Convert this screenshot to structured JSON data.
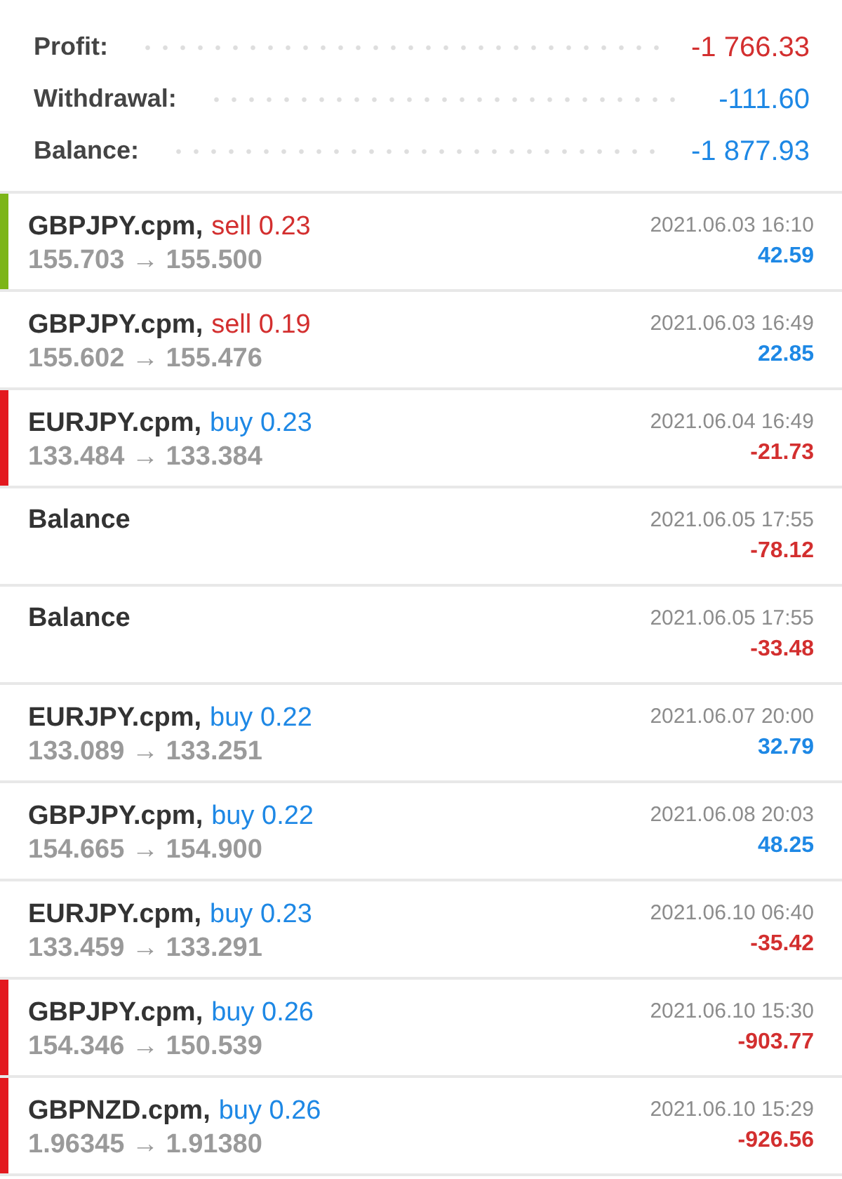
{
  "summary": [
    {
      "label": "Profit:",
      "value": "-1 766.33",
      "color": "#d32f2f"
    },
    {
      "label": "Withdrawal:",
      "value": "-111.60",
      "color": "#1e88e5"
    },
    {
      "label": "Balance:",
      "value": "-1 877.93",
      "color": "#1e88e5"
    }
  ],
  "rows": [
    {
      "kind": "trade",
      "color": "#7cb518",
      "symbol": "GBPJPY.cpm,",
      "order": {
        "text": "sell 0.23",
        "color": "#d32f2f"
      },
      "prices": "155.703 → 155.500",
      "time": "2021.06.03 16:10",
      "profit": {
        "text": "42.59",
        "color": "#1e88e5"
      }
    },
    {
      "kind": "trade",
      "symbol": "GBPJPY.cpm,",
      "order": {
        "text": "sell 0.19",
        "color": "#d32f2f"
      },
      "prices": "155.602 → 155.476",
      "time": "2021.06.03 16:49",
      "profit": {
        "text": "22.85",
        "color": "#1e88e5"
      }
    },
    {
      "kind": "trade",
      "color": "#e3191f",
      "symbol": "EURJPY.cpm,",
      "order": {
        "text": "buy 0.23",
        "color": "#1e88e5"
      },
      "prices": "133.484 → 133.384",
      "time": "2021.06.04 16:49",
      "profit": {
        "text": "-21.73",
        "color": "#d32f2f"
      }
    },
    {
      "kind": "balance",
      "title": "Balance",
      "time": "2021.06.05 17:55",
      "profit": {
        "text": "-78.12",
        "color": "#d32f2f"
      }
    },
    {
      "kind": "balance",
      "title": "Balance",
      "time": "2021.06.05 17:55",
      "profit": {
        "text": "-33.48",
        "color": "#d32f2f"
      }
    },
    {
      "kind": "trade",
      "symbol": "EURJPY.cpm,",
      "order": {
        "text": "buy 0.22",
        "color": "#1e88e5"
      },
      "prices": "133.089 → 133.251",
      "time": "2021.06.07 20:00",
      "profit": {
        "text": "32.79",
        "color": "#1e88e5"
      }
    },
    {
      "kind": "trade",
      "symbol": "GBPJPY.cpm,",
      "order": {
        "text": "buy 0.22",
        "color": "#1e88e5"
      },
      "prices": "154.665 → 154.900",
      "time": "2021.06.08 20:03",
      "profit": {
        "text": "48.25",
        "color": "#1e88e5"
      }
    },
    {
      "kind": "trade",
      "symbol": "EURJPY.cpm,",
      "order": {
        "text": "buy 0.23",
        "color": "#1e88e5"
      },
      "prices": "133.459 → 133.291",
      "time": "2021.06.10 06:40",
      "profit": {
        "text": "-35.42",
        "color": "#d32f2f"
      }
    },
    {
      "kind": "trade",
      "color": "#e3191f",
      "symbol": "GBPJPY.cpm,",
      "order": {
        "text": "buy 0.26",
        "color": "#1e88e5"
      },
      "prices": "154.346 → 150.539",
      "time": "2021.06.10 15:30",
      "profit": {
        "text": "-903.77",
        "color": "#d32f2f"
      }
    },
    {
      "kind": "trade",
      "color": "#e3191f",
      "symbol": "GBPNZD.cpm,",
      "order": {
        "text": "buy 0.26",
        "color": "#1e88e5"
      },
      "prices": "1.96345 → 1.91380",
      "time": "2021.06.10 15:29",
      "profit": {
        "text": "-926.56",
        "color": "#d32f2f"
      }
    }
  ]
}
